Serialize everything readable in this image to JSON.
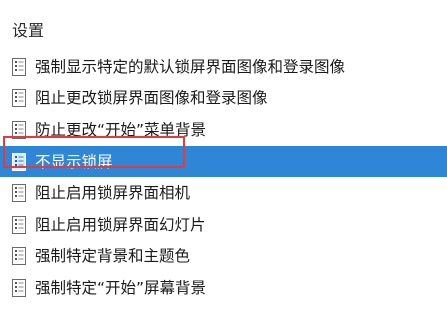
{
  "folder": {
    "title": "设置"
  },
  "settings": [
    {
      "label": "强制显示特定的默认锁屏界面图像和登录图像",
      "icon": "policy-setting-icon",
      "selected": false
    },
    {
      "label": "阻止更改锁屏界面图像和登录图像",
      "icon": "policy-setting-icon",
      "selected": false
    },
    {
      "label": "防止更改“开始”菜单背景",
      "icon": "policy-setting-icon",
      "selected": false
    },
    {
      "label": "不显示锁屏",
      "icon": "policy-setting-icon",
      "selected": true
    },
    {
      "label": "阻止启用锁屏界面相机",
      "icon": "policy-setting-icon",
      "selected": false
    },
    {
      "label": "阻止启用锁屏界面幻灯片",
      "icon": "policy-setting-icon",
      "selected": false
    },
    {
      "label": "强制特定背景和主题色",
      "icon": "policy-setting-icon",
      "selected": false
    },
    {
      "label": "强制特定“开始”屏幕背景",
      "icon": "policy-setting-icon",
      "selected": false
    }
  ],
  "colors": {
    "selection": "#2f86d6",
    "annotation_box": "#e23b3b"
  }
}
